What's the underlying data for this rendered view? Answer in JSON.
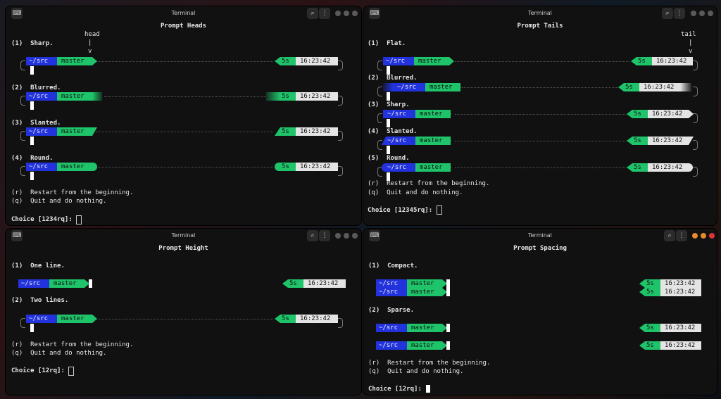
{
  "window_title": "Terminal",
  "icons": {
    "terminal": "terminal-icon",
    "search": "search-icon",
    "menu": "kebab-menu-icon"
  },
  "colors": {
    "dir_bg": "#2233dd",
    "git_bg": "#1fc46a",
    "time_bg": "#e4e4e4",
    "win_orange": "#e8892c",
    "win_red": "#dd3333"
  },
  "segments": {
    "dir": "~/src",
    "branch": "master",
    "duration": "5s",
    "clock": "16:23:42"
  },
  "heads": {
    "title": "Prompt Heads",
    "marker": "head",
    "marker_bar": "|",
    "marker_arrow": "v",
    "options": [
      "(1)  Sharp.",
      "(2)  Blurred.",
      "(3)  Slanted.",
      "(4)  Round."
    ],
    "restart": "(r)  Restart from the beginning.",
    "quit": "(q)  Quit and do nothing.",
    "choice": "Choice [1234rq]:"
  },
  "tails": {
    "title": "Prompt Tails",
    "marker": "tail",
    "marker_bar": "|",
    "marker_arrow": "v",
    "options": [
      "(1)  Flat.",
      "(2)  Blurred.",
      "(3)  Sharp.",
      "(4)  Slanted.",
      "(5)  Round."
    ],
    "restart": "(r)  Restart from the beginning.",
    "quit": "(q)  Quit and do nothing.",
    "choice": "Choice [12345rq]:"
  },
  "height": {
    "title": "Prompt Height",
    "options": [
      "(1)  One line.",
      "(2)  Two lines."
    ],
    "restart": "(r)  Restart from the beginning.",
    "quit": "(q)  Quit and do nothing.",
    "choice": "Choice [12rq]:"
  },
  "spacing": {
    "title": "Prompt Spacing",
    "options": [
      "(1)  Compact.",
      "(2)  Sparse."
    ],
    "restart": "(r)  Restart from the beginning.",
    "quit": "(q)  Quit and do nothing.",
    "choice": "Choice [12rq]:"
  }
}
